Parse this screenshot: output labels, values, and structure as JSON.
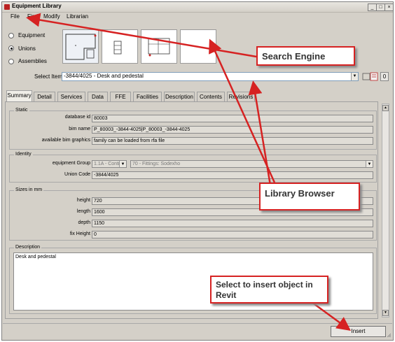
{
  "window": {
    "title": "Equipment Library",
    "buttons": [
      "_",
      "□",
      "×"
    ]
  },
  "menu": [
    "File",
    "Find",
    "Modify",
    "Librarian"
  ],
  "category": {
    "options": [
      "Equipment",
      "Unions",
      "Assemblies"
    ],
    "selected": "Unions"
  },
  "select_item": {
    "label": "Select Item",
    "value": "-3844/4025 - Desk and pedestal",
    "count": "0"
  },
  "tabs": [
    "Summary",
    "Detail",
    "Services",
    "Data",
    "FFE",
    "Facilities",
    "Description",
    "Contents",
    "Revisions"
  ],
  "active_tab": "Summary",
  "static": {
    "title": "Static",
    "database_id_label": "database id",
    "database_id": "80003",
    "bim_name_label": "bim name",
    "bim_name": "P_80003_-3844-4025|P_80003_-3844-4025",
    "bim_graphics_label": "available bim graphics",
    "bim_graphics": "family can be loaded from rfa file"
  },
  "identity": {
    "title": "Identity",
    "equipment_group_label": "equipment Group",
    "equipment_group": "1.1A - Contr",
    "equipment_subgroup": "70 - Fittings: Sodexho",
    "union_code_label": "Union Code",
    "union_code": "-3844/4025"
  },
  "sizes": {
    "title": "Sizes in mm",
    "height_label": "height",
    "height": "720",
    "length_label": "length",
    "length": "1600",
    "depth_label": "depth",
    "depth": "1150",
    "fix_height_label": "fix Height",
    "fix_height": "0"
  },
  "description": {
    "title": "Description",
    "text": "Desk and pedestal"
  },
  "insert_label": "Insert",
  "callouts": {
    "search": "Search Engine",
    "library": "Library Browser",
    "insert": "Select to insert object in Revit"
  },
  "colors": {
    "callout_border": "#d62222",
    "arrow": "#d62222"
  }
}
